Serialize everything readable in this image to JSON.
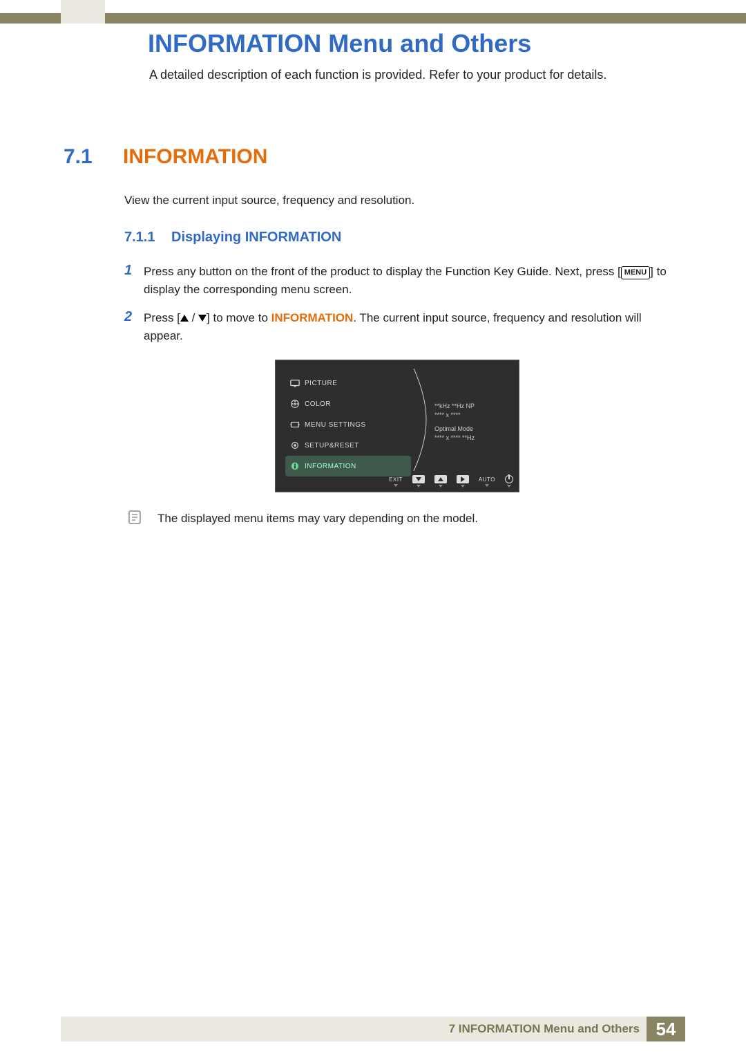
{
  "page_title": "INFORMATION Menu and Others",
  "intro": "A detailed description of each function is provided. Refer to your product for details.",
  "section": {
    "number": "7.1",
    "title": "INFORMATION",
    "desc": "View the current input source, frequency and resolution."
  },
  "subsection": {
    "number": "7.1.1",
    "title": "Displaying INFORMATION"
  },
  "steps": {
    "s1_num": "1",
    "s1_a": "Press any button on the front of the product to display the Function Key Guide. Next, press [",
    "s1_menu": "MENU",
    "s1_b": "] to display the corresponding menu screen.",
    "s2_num": "2",
    "s2_a": "Press [",
    "s2_b": "] to move to ",
    "s2_info": "INFORMATION",
    "s2_c": ". The current input source, frequency and resolution will appear."
  },
  "osd": {
    "menu": [
      "PICTURE",
      "COLOR",
      "MENU SETTINGS",
      "SETUP&RESET",
      "INFORMATION"
    ],
    "info_l1": "**kHz **Hz NP",
    "info_l2": "**** x ****",
    "info_l3": "Optimal Mode",
    "info_l4": "**** x **** **Hz",
    "btn_exit": "EXIT",
    "btn_auto": "AUTO"
  },
  "note": "The displayed menu items may vary depending on the model.",
  "footer": {
    "text": "7 INFORMATION Menu and Others",
    "page": "54"
  }
}
